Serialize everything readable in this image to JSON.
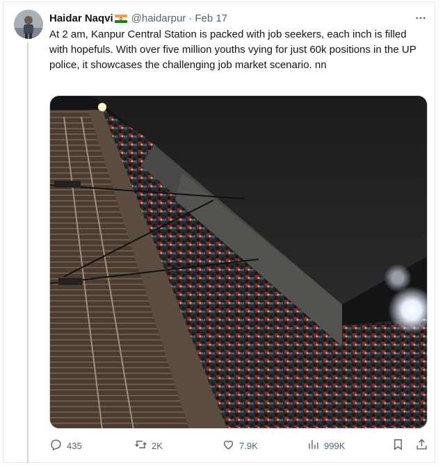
{
  "tweet": {
    "author_name": "Haidar Naqvi",
    "flag": "india-flag",
    "handle": "@haidarpur",
    "separator": "·",
    "date": "Feb 17",
    "text": "At 2 am, Kanpur Central Station is packed with job seekers, each inch is filled with hopefuls. With over five million youths vying for just 60k positions in the UP police, it showcases the challenging job market scenario. nn"
  },
  "actions": {
    "replies": "435",
    "reposts": "2K",
    "likes": "7.9K",
    "views": "999K"
  },
  "icons": {
    "more": "more-icon",
    "reply": "reply-icon",
    "repost": "repost-icon",
    "like": "heart-icon",
    "views": "views-icon",
    "bookmark": "bookmark-icon",
    "share": "share-icon"
  },
  "colors": {
    "text_primary": "#0f1419",
    "text_secondary": "#536471",
    "thread_line": "#cfd9de",
    "border": "#e6e9eb"
  }
}
